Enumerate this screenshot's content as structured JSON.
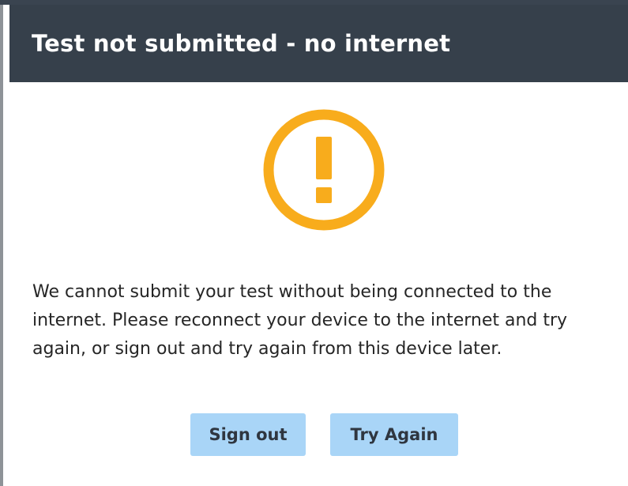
{
  "dialog": {
    "title": "Test not submitted - no internet",
    "icon": "warning-circle-icon",
    "message_lines": "We cannot submit your test without being connected to the\ninternet. Please reconnect your device to the internet and try\nagain, or sign out and try again from this device later.",
    "buttons": {
      "sign_out": "Sign out",
      "try_again": "Try Again"
    }
  },
  "colors": {
    "header_bg": "#36404b",
    "warning": "#f8ac1c",
    "button_bg": "#a9d5f7"
  }
}
